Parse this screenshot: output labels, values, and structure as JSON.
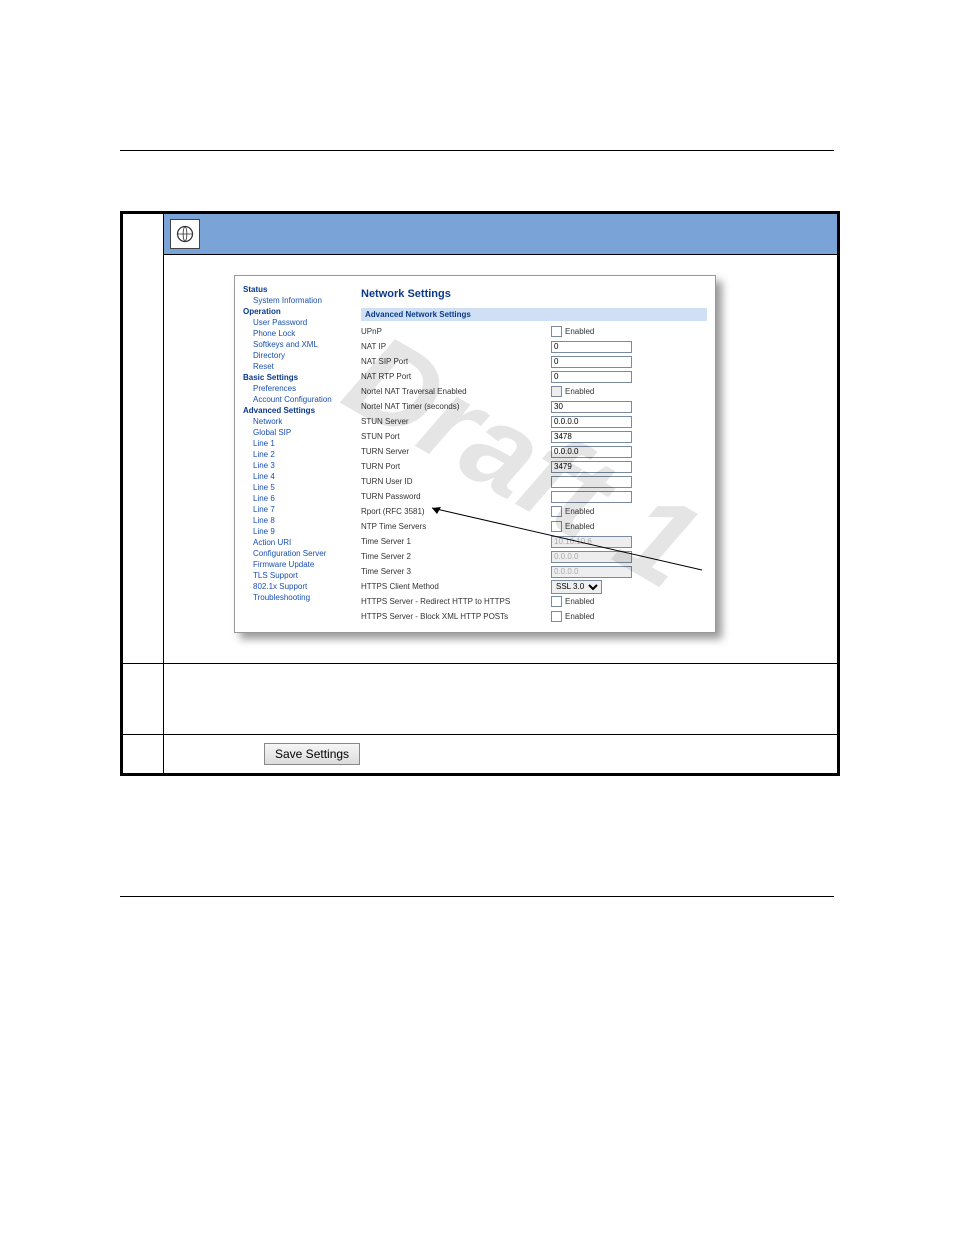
{
  "nav": {
    "status_hdr": "Status",
    "system_information": "System Information",
    "operation_hdr": "Operation",
    "user_password": "User Password",
    "phone_lock": "Phone Lock",
    "softkeys_xml": "Softkeys and XML",
    "directory": "Directory",
    "reset": "Reset",
    "basic_hdr": "Basic Settings",
    "preferences": "Preferences",
    "account_config": "Account Configuration",
    "advanced_hdr": "Advanced Settings",
    "network": "Network",
    "global_sip": "Global SIP",
    "line1": "Line 1",
    "line2": "Line 2",
    "line3": "Line 3",
    "line4": "Line 4",
    "line5": "Line 5",
    "line6": "Line 6",
    "line7": "Line 7",
    "line8": "Line 8",
    "line9": "Line 9",
    "action_uri": "Action URI",
    "config_server": "Configuration Server",
    "firmware_update": "Firmware Update",
    "tls_support": "TLS Support",
    "dot1x_support": "802.1x Support",
    "troubleshooting": "Troubleshooting"
  },
  "main": {
    "title": "Network Settings",
    "section": "Advanced Network Settings",
    "upnp": "UPnP",
    "nat_ip": "NAT IP",
    "nat_sip_port": "NAT SIP Port",
    "nat_rtp_port": "NAT RTP Port",
    "nortel_nat_enabled": "Nortel NAT Traversal Enabled",
    "nortel_nat_timer": "Nortel NAT Timer (seconds)",
    "stun_server": "STUN Server",
    "stun_port": "STUN Port",
    "turn_server": "TURN Server",
    "turn_port": "TURN Port",
    "turn_user": "TURN User ID",
    "turn_pass": "TURN Password",
    "rport": "Rport (RFC 3581)",
    "ntp_time_servers": "NTP Time Servers",
    "time_server1": "Time Server 1",
    "time_server2": "Time Server 2",
    "time_server3": "Time Server 3",
    "https_client_method": "HTTPS Client Method",
    "https_redirect": "HTTPS Server - Redirect HTTP to HTTPS",
    "https_block_xml": "HTTPS Server - Block XML HTTP POSTs",
    "enabled_label": "Enabled"
  },
  "values": {
    "nat_ip": "0",
    "nat_sip_port": "0",
    "nat_rtp_port": "0",
    "nortel_nat_timer": "30",
    "stun_server": "0.0.0.0",
    "stun_port": "3478",
    "turn_server": "0.0.0.0",
    "turn_port": "3479",
    "turn_user": "",
    "turn_pass": "",
    "time_server1": "10.10.10.6",
    "time_server2": "0.0.0.0",
    "time_server3": "0.0.0.0",
    "https_client_method": "SSL 3.0"
  },
  "watermark": "Draft 1",
  "save_label": "Save Settings"
}
